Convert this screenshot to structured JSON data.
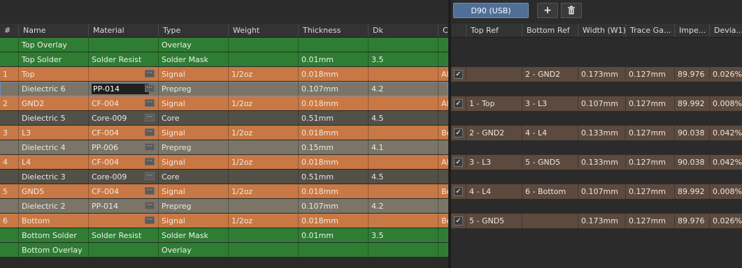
{
  "toolbar": {
    "impedance_profile": "D90 (USB)",
    "add_icon": "plus-icon",
    "delete_icon": "trash-icon"
  },
  "layer_columns": [
    "#",
    "Name",
    "Material",
    "Type",
    "Weight",
    "Thickness",
    "Dk",
    "C"
  ],
  "layers": [
    {
      "num": "",
      "name": "Top Overlay",
      "material": "",
      "type": "Overlay",
      "weight": "",
      "thickness": "",
      "dk": "",
      "c": "",
      "style": "green"
    },
    {
      "num": "",
      "name": "Top Solder",
      "material": "Solder Resist",
      "type": "Solder Mask",
      "weight": "",
      "thickness": "0.01mm",
      "dk": "3.5",
      "c": "",
      "style": "green"
    },
    {
      "num": "1",
      "name": "Top",
      "material": "",
      "type": "Signal",
      "weight": "1/2oz",
      "thickness": "0.018mm",
      "dk": "",
      "c": "Al",
      "style": "orange"
    },
    {
      "num": "",
      "name": "Dielectric 6",
      "material": "PP-014",
      "type": "Prepreg",
      "weight": "",
      "thickness": "0.107mm",
      "dk": "4.2",
      "c": "",
      "style": "gray"
    },
    {
      "num": "2",
      "name": "GND2",
      "material": "CF-004",
      "type": "Signal",
      "weight": "1/2oz",
      "thickness": "0.018mm",
      "dk": "",
      "c": "Al",
      "style": "orange"
    },
    {
      "num": "",
      "name": "Dielectric 5",
      "material": "Core-009",
      "type": "Core",
      "weight": "",
      "thickness": "0.51mm",
      "dk": "4.5",
      "c": "",
      "style": "dark"
    },
    {
      "num": "3",
      "name": "L3",
      "material": "CF-004",
      "type": "Signal",
      "weight": "1/2oz",
      "thickness": "0.018mm",
      "dk": "",
      "c": "Be",
      "style": "orange"
    },
    {
      "num": "",
      "name": "Dielectric 4",
      "material": "PP-006",
      "type": "Prepreg",
      "weight": "",
      "thickness": "0.15mm",
      "dk": "4.1",
      "c": "",
      "style": "gray"
    },
    {
      "num": "4",
      "name": "L4",
      "material": "CF-004",
      "type": "Signal",
      "weight": "1/2oz",
      "thickness": "0.018mm",
      "dk": "",
      "c": "Al",
      "style": "orange"
    },
    {
      "num": "",
      "name": "Dielectric 3",
      "material": "Core-009",
      "type": "Core",
      "weight": "",
      "thickness": "0.51mm",
      "dk": "4.5",
      "c": "",
      "style": "dark"
    },
    {
      "num": "5",
      "name": "GND5",
      "material": "CF-004",
      "type": "Signal",
      "weight": "1/2oz",
      "thickness": "0.018mm",
      "dk": "",
      "c": "Be",
      "style": "orange"
    },
    {
      "num": "",
      "name": "Dielectric 2",
      "material": "PP-014",
      "type": "Prepreg",
      "weight": "",
      "thickness": "0.107mm",
      "dk": "4.2",
      "c": "",
      "style": "gray"
    },
    {
      "num": "6",
      "name": "Bottom",
      "material": "",
      "type": "Signal",
      "weight": "1/2oz",
      "thickness": "0.018mm",
      "dk": "",
      "c": "Be",
      "style": "orange"
    },
    {
      "num": "",
      "name": "Bottom Solder",
      "material": "Solder Resist",
      "type": "Solder Mask",
      "weight": "",
      "thickness": "0.01mm",
      "dk": "3.5",
      "c": "",
      "style": "green"
    },
    {
      "num": "",
      "name": "Bottom Overlay",
      "material": "",
      "type": "Overlay",
      "weight": "",
      "thickness": "",
      "dk": "",
      "c": "",
      "style": "green"
    }
  ],
  "impedance_columns": [
    "Top Ref",
    "Bottom Ref",
    "Width (W1)",
    "Trace Ga...",
    "Impe...",
    "Devia..."
  ],
  "impedance_rows": [
    {
      "checked": true,
      "top_ref": "",
      "bottom_ref": "2 - GND2",
      "width": "0.173mm",
      "gap": "0.127mm",
      "imp": "89.976",
      "dev": "0.026%"
    },
    {
      "checked": true,
      "top_ref": "1 - Top",
      "bottom_ref": "3 - L3",
      "width": "0.107mm",
      "gap": "0.127mm",
      "imp": "89.992",
      "dev": "0.008%"
    },
    {
      "checked": true,
      "top_ref": "2 - GND2",
      "bottom_ref": "4 - L4",
      "width": "0.133mm",
      "gap": "0.127mm",
      "imp": "90.038",
      "dev": "0.042%"
    },
    {
      "checked": true,
      "top_ref": "3 - L3",
      "bottom_ref": "5 - GND5",
      "width": "0.133mm",
      "gap": "0.127mm",
      "imp": "90.038",
      "dev": "0.042%"
    },
    {
      "checked": true,
      "top_ref": "4 - L4",
      "bottom_ref": "6 - Bottom",
      "width": "0.107mm",
      "gap": "0.127mm",
      "imp": "89.992",
      "dev": "0.008%"
    },
    {
      "checked": true,
      "top_ref": "5 - GND5",
      "bottom_ref": "",
      "width": "0.173mm",
      "gap": "0.127mm",
      "imp": "89.976",
      "dev": "0.026%"
    }
  ]
}
